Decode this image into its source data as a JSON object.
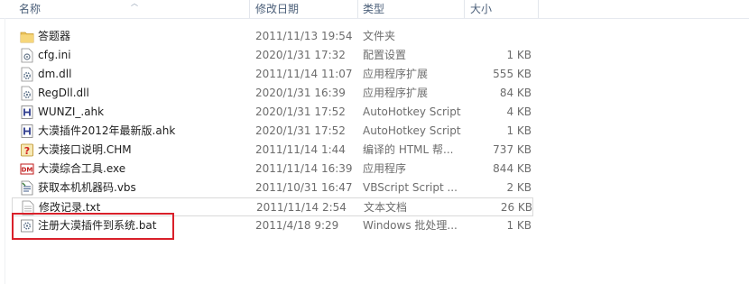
{
  "columns": {
    "name": "名称",
    "date": "修改日期",
    "type": "类型",
    "size": "大小"
  },
  "colors": {
    "header_text": "#4c607a",
    "secondary_text": "#6d6d6d",
    "highlight": "#d9202a",
    "folder": "#e9c15a"
  },
  "files": [
    {
      "name": "答题器",
      "date": "2011/11/13 19:54",
      "type": "文件夹",
      "size": "",
      "icon": "folder-icon"
    },
    {
      "name": "cfg.ini",
      "date": "2020/1/31 17:32",
      "type": "配置设置",
      "size": "1 KB",
      "icon": "config-file-icon"
    },
    {
      "name": "dm.dll",
      "date": "2011/11/14 11:07",
      "type": "应用程序扩展",
      "size": "555 KB",
      "icon": "dll-file-icon"
    },
    {
      "name": "RegDll.dll",
      "date": "2020/1/31 16:39",
      "type": "应用程序扩展",
      "size": "84 KB",
      "icon": "dll-file-icon"
    },
    {
      "name": "WUNZI_.ahk",
      "date": "2020/1/31 17:52",
      "type": "AutoHotkey Script",
      "size": "4 KB",
      "icon": "ahk-script-icon"
    },
    {
      "name": "大漠插件2012年最新版.ahk",
      "date": "2020/1/31 17:52",
      "type": "AutoHotkey Script",
      "size": "1 KB",
      "icon": "ahk-script-icon"
    },
    {
      "name": "大漠接口说明.CHM",
      "date": "2011/11/14 1:44",
      "type": "编译的 HTML 帮...",
      "size": "737 KB",
      "icon": "chm-help-icon"
    },
    {
      "name": "大漠综合工具.exe",
      "date": "2011/11/14 16:39",
      "type": "应用程序",
      "size": "844 KB",
      "icon": "dm-app-icon"
    },
    {
      "name": "获取本机机器码.vbs",
      "date": "2011/10/31 16:47",
      "type": "VBScript Script ...",
      "size": "2 KB",
      "icon": "vbs-script-icon"
    },
    {
      "name": "修改记录.txt",
      "date": "2011/11/14 2:54",
      "type": "文本文档",
      "size": "26 KB",
      "icon": "text-file-icon"
    },
    {
      "name": "注册大漠插件到系统.bat",
      "date": "2011/4/18 9:29",
      "type": "Windows 批处理...",
      "size": "1 KB",
      "icon": "batch-file-icon"
    }
  ]
}
